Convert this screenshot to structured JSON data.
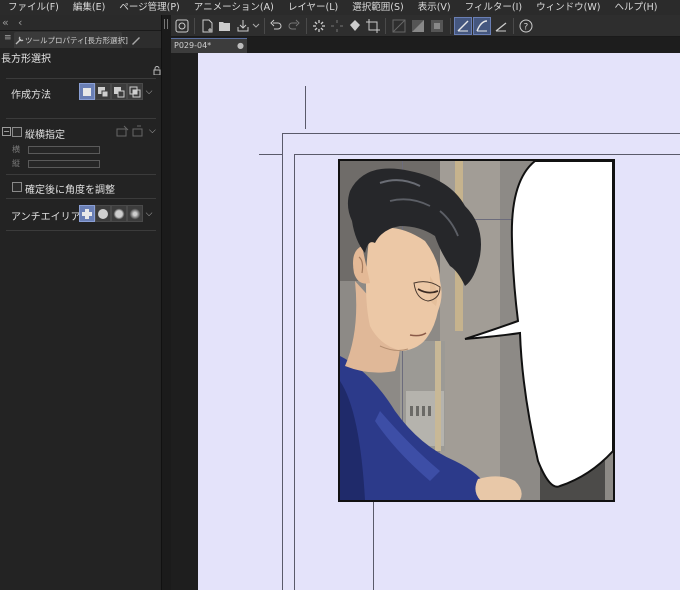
{
  "menubar": {
    "items": [
      "ファイル(F)",
      "編集(E)",
      "ページ管理(P)",
      "アニメーション(A)",
      "レイヤー(L)",
      "選択範囲(S)",
      "表示(V)",
      "フィルター(I)",
      "ウィンドウ(W)",
      "ヘルプ(H)"
    ]
  },
  "panel": {
    "collapse_icon": "double-chevron-left-icon",
    "tab_label": "ツールプロパティ[長方形選択]",
    "tool_name": "長方形選択",
    "create_method": {
      "label": "作成方法",
      "modes": [
        "new-selection",
        "add-selection",
        "subtract-selection",
        "intersect-selection"
      ],
      "active_index": 0
    },
    "aspect": {
      "label": "縦横指定",
      "checked": false,
      "width_label": "横",
      "height_label": "縦"
    },
    "adjust_angle": {
      "label": "確定後に角度を調整",
      "checked": false
    },
    "antialias": {
      "label": "アンチエイリアス",
      "levels": [
        "none",
        "weak",
        "medium",
        "strong"
      ],
      "active_index": 0
    }
  },
  "toolbar": {
    "icons": [
      "canvas-icon",
      "new-file-icon",
      "open-folder-icon",
      "export-icon",
      "undo-icon",
      "redo-icon",
      "loading-icon",
      "transform-icon",
      "fill-icon",
      "crop-icon",
      "deselect-icon",
      "invert-selection-icon",
      "expand-selection-icon",
      "snap-icon",
      "snap-curve-icon",
      "ruler-icon",
      "help-icon"
    ],
    "active": [
      "snap-icon",
      "snap-curve-icon"
    ]
  },
  "document": {
    "tab_name": "P029-04*",
    "modified_dot": "●"
  },
  "colors": {
    "accent": "#6a7fb5",
    "pasteboard": "#e4e3fa",
    "panel_bg": "#232323"
  }
}
